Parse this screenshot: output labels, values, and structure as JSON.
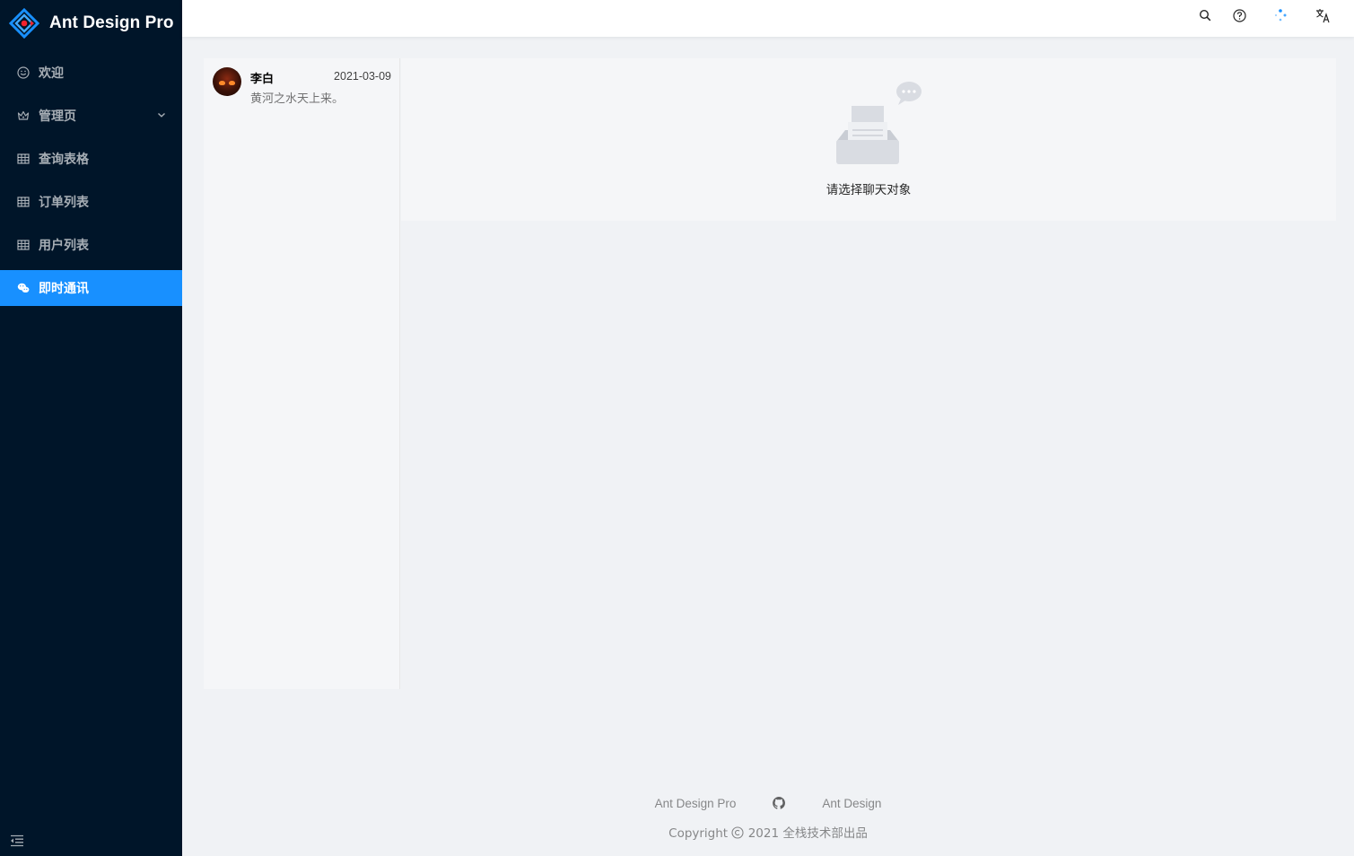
{
  "app": {
    "title": "Ant Design Pro"
  },
  "sidebar": {
    "items": [
      {
        "label": "欢迎",
        "icon": "smile-icon"
      },
      {
        "label": "管理页",
        "icon": "crown-icon",
        "has_submenu": true
      },
      {
        "label": "查询表格",
        "icon": "table-icon"
      },
      {
        "label": "订单列表",
        "icon": "table-icon"
      },
      {
        "label": "用户列表",
        "icon": "table-icon"
      },
      {
        "label": "即时通讯",
        "icon": "wechat-icon",
        "active": true
      }
    ]
  },
  "header": {
    "icons": [
      "search-icon",
      "question-icon",
      "dots-icon",
      "translate-icon"
    ]
  },
  "chat_list": {
    "items": [
      {
        "name": "李白",
        "time": "2021-03-09",
        "message": "黄河之水天上来。"
      }
    ]
  },
  "chat_main": {
    "empty_text": "请选择聊天对象"
  },
  "footer": {
    "links": [
      "Ant Design Pro",
      "Ant Design"
    ],
    "copyright_prefix": "Copyright",
    "copyright_text": "2021 全栈技术部出品"
  },
  "colors": {
    "sidebar_bg": "#001529",
    "accent": "#1890ff",
    "page_bg": "#f0f2f5"
  }
}
